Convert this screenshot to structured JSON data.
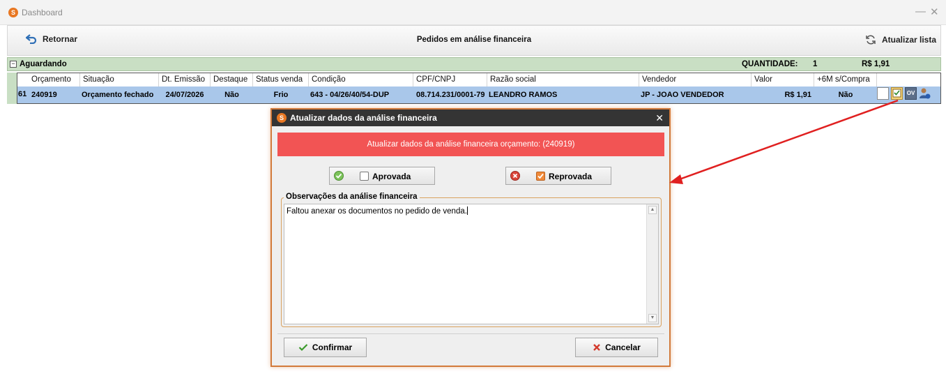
{
  "window": {
    "title": "Dashboard",
    "minimize": "—",
    "close": "✕",
    "logo": "S"
  },
  "toolbar": {
    "back_label": "Retornar",
    "title": "Pedidos em análise financeira",
    "refresh_label": "Atualizar lista"
  },
  "group": {
    "label": "Aguardando",
    "expander": "−",
    "quantity_label": "QUANTIDADE:",
    "quantity_value": "1",
    "total": "R$ 1,91"
  },
  "grid": {
    "row_prefix": "61",
    "columns": [
      "Orçamento",
      "Situação",
      "Dt. Emissão",
      "Destaque",
      "Status venda",
      "Condição",
      "CPF/CNPJ",
      "Razão social",
      "Vendedor",
      "Valor",
      "+6M s/Compra"
    ],
    "rows": [
      {
        "orcamento": "240919",
        "situacao": "Orçamento fechado",
        "dt_emissao": "24/07/2026",
        "destaque": "Não",
        "status_venda": "Frio",
        "condicao": "643 - 04/26/40/54-DUP",
        "cpf_cnpj": "08.714.231/0001-79",
        "razao_social": "LEANDRO RAMOS",
        "vendedor": "JP - JOAO VENDEDOR",
        "valor": "R$ 1,91",
        "seis_meses": "Não",
        "ov_label": "OV"
      }
    ]
  },
  "dialog": {
    "title": "Atualizar dados da análise financeira",
    "close": "✕",
    "banner": "Atualizar dados da análise financeira orçamento: (240919)",
    "approve_label": "Aprovada",
    "reject_label": "Reprovada",
    "approve_checked": false,
    "reject_checked": true,
    "observations_legend": "Observações da análise financeira",
    "observations_text": "Faltou anexar os documentos no pedido de venda.",
    "confirm_label": "Confirmar",
    "cancel_label": "Cancelar"
  },
  "colors": {
    "banner": "#f25454",
    "group_band": "#c9dfc4",
    "selected_row": "#a9c7ea",
    "dialog_border": "#d27a3a",
    "arrow": "#e02020"
  }
}
